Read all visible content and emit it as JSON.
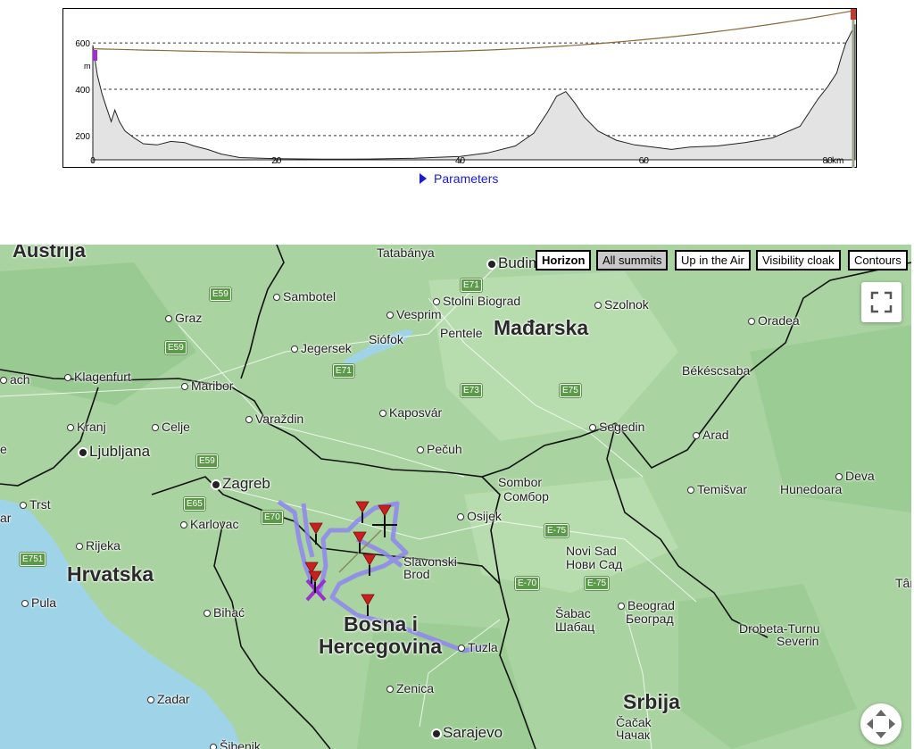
{
  "profile": {
    "y_ticks": [
      "600",
      "400",
      "200"
    ],
    "y_unit": "m",
    "x_ticks": [
      "0",
      "20",
      "40",
      "60",
      "80"
    ],
    "x_unit": "km",
    "xlim": [
      0,
      83
    ],
    "ylim": [
      80,
      720
    ],
    "colors": {
      "fill": "#e3e3e3",
      "line": "#222222",
      "sightline": "#8a6a3a",
      "start": "#9b2fd0",
      "end": "#c0392b"
    }
  },
  "parameters_label": "Parameters",
  "map_buttons": [
    {
      "label": "Horizon",
      "state": "bold"
    },
    {
      "label": "All summits",
      "state": "on"
    },
    {
      "label": "Up in the Air",
      "state": ""
    },
    {
      "label": "Visibility cloak",
      "state": ""
    },
    {
      "label": "Contours",
      "state": ""
    }
  ],
  "map": {
    "countries": {
      "austria": "Austrija",
      "hungary": "Mađarska",
      "croatia": "Hrvatska",
      "bosnia_1": "Bosna i",
      "bosnia_2": "Hercegovina",
      "serbia": "Srbija"
    },
    "capitals": {
      "budapest": "Budim",
      "ljubljana": "Ljubljana",
      "zagreb": "Zagreb",
      "sarajevo": "Sarajevo"
    },
    "cities": {
      "tatabanya": "Tatabánya",
      "graz": "Graz",
      "sambotel": "Sambotel",
      "vesprim": "Vesprim",
      "stolni": "Stolni Biograd",
      "szolnok": "Szolnok",
      "jegersek": "Jegersek",
      "siofok": "Siófok",
      "pentele": "Pentele",
      "oradea": "Oradea",
      "klagenfurt": "Klagenfurt",
      "ach": "ach",
      "maribor": "Maribor",
      "bekescsaba": "Békéscsaba",
      "kranj": "Kranj",
      "celje": "Celje",
      "varazdin": "Varaždin",
      "kaposvar": "Kaposvár",
      "segedin": "Segedin",
      "arad": "Arad",
      "pecuh": "Pečuh",
      "sombor_lat": "Sombor",
      "sombor_cyr": "Сомбор",
      "temisvar": "Temišvar",
      "hunedoara": "Hunedoara",
      "deva": "Deva",
      "trst": "Trst",
      "karlovac": "Karlovac",
      "osijek": "Osijek",
      "ar": "ar",
      "rijeka": "Rijeka",
      "slavonski_1": "Slavonski",
      "slavonski_2": "Brod",
      "novisad_lat": "Novi Sad",
      "novisad_cyr": "Нови Сад",
      "pula": "Pula",
      "bihac": "Bihać",
      "sabac_lat": "Šabac",
      "sabac_cyr": "Шабац",
      "beograd_lat": "Beograd",
      "beograd_cyr": "Београд",
      "targu": "Târgu",
      "drobeta": "Drobeta-Turnu",
      "severin": "Severin",
      "tuzla": "Tuzla",
      "zenica": "Zenica",
      "zadar": "Zadar",
      "cacak_lat": "Čačak",
      "cacak_cyr": "Чачак",
      "sibenik": "Šibenik",
      "e_left": "e"
    },
    "roads": {
      "e59a": "E59",
      "e71a": "E71",
      "e59b": "E59",
      "e71b": "E71",
      "e73": "E73",
      "e75a": "E75",
      "e59c": "E59",
      "e65": "E65",
      "e70a": "E70",
      "e75b": "E-75",
      "e751": "E751",
      "e70b": "E-70",
      "e75c": "E-75"
    },
    "colors": {
      "land": "#a9d3a0",
      "sea": "#9fd3e8",
      "track": "#8f86f0",
      "marker": "#c8201e"
    },
    "icons": {
      "fullscreen": "fullscreen-icon",
      "pan": "pan-arrows-icon",
      "marker": "summit-marker-icon"
    }
  }
}
